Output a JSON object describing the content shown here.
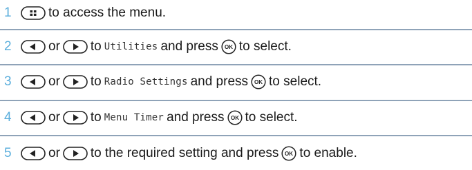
{
  "accent_color": "#5aaedc",
  "divider_color": "#8fa3b8",
  "steps": [
    {
      "number": "1",
      "text_after_key": "to access the menu."
    },
    {
      "number": "2",
      "or": "or",
      "to": "to",
      "item": "Utilities",
      "and_press": "and press",
      "action": "to select."
    },
    {
      "number": "3",
      "or": "or",
      "to": "to",
      "item": "Radio Settings",
      "and_press": "and press",
      "action": "to select."
    },
    {
      "number": "4",
      "or": "or",
      "to": "to",
      "item": "Menu Timer",
      "and_press": "and press",
      "action": "to select."
    },
    {
      "number": "5",
      "or": "or",
      "text": "to the required setting and press",
      "action": "to enable."
    }
  ],
  "icons": {
    "menu_key": "menu-button-icon",
    "left_key": "left-arrow-button-icon",
    "right_key": "right-arrow-button-icon",
    "ok_key": "ok-button-icon",
    "ok_label": "OK"
  }
}
